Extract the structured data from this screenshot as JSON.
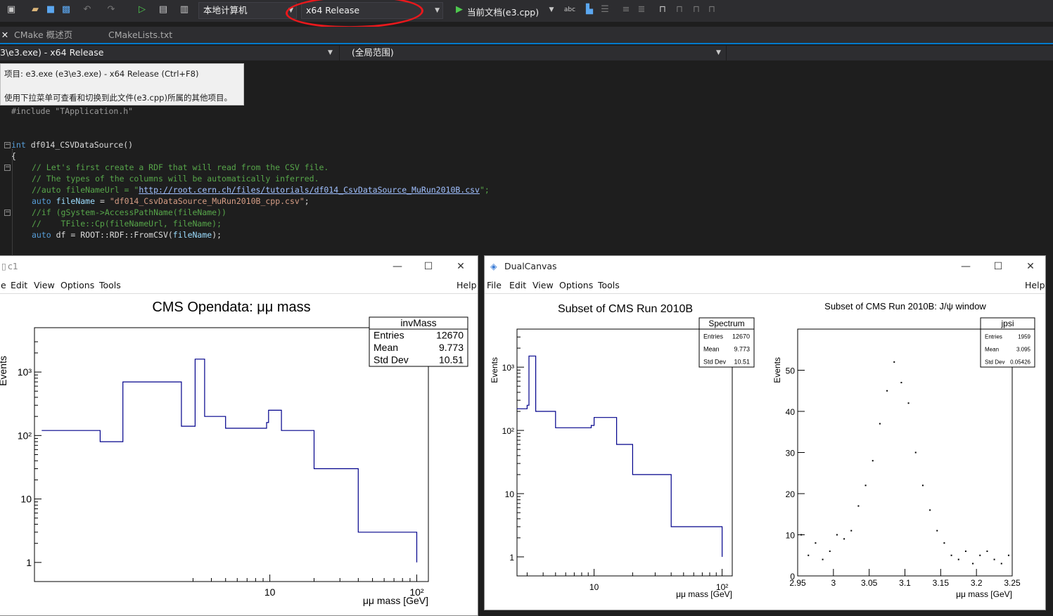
{
  "toolbar": {
    "machine_dropdown": "本地计算机",
    "config_dropdown": "x64 Release",
    "startup_target": "当前文档(e3.cpp)",
    "spell_icon_label": "abc"
  },
  "tabs": [
    {
      "label": "CMake 概述页"
    },
    {
      "label": "CMakeLists.txt"
    }
  ],
  "navbar": {
    "project": "3\\e3.exe) - x64 Release",
    "scope": "(全局范围)"
  },
  "tooltip": {
    "line1": "项目: e3.exe (e3\\e3.exe) - x64 Release (Ctrl+F8)",
    "line2": "使用下拉菜单可查看和切换到此文件(e3.cpp)所属的其他项目。"
  },
  "code": {
    "include": "#include \"TApplication.h\"",
    "fn_kw": "int",
    "fn_name": " df014_CSVDataSource()",
    "brace": "{",
    "c1": "// Let's first create a RDF that will read from the CSV file.",
    "c2": "// The types of the columns will be automatically inferred.",
    "c3_pre": "//auto fileNameUrl = \"",
    "c3_link": "http://root.cern.ch/files/tutorials/df014_CsvDataSource_MuRun2010B.csv",
    "c3_post": "\";",
    "l4_kw": "auto",
    "l4_id": "fileName",
    "l4_eq": " = ",
    "l4_str": "\"df014_CsvDataSource_MuRun2010B_cpp.csv\"",
    "l4_end": ";",
    "c5": "//if (gSystem->AccessPathName(fileName))",
    "c6": "//    TFile::Cp(fileNameUrl, fileName);",
    "l7_kw": "auto",
    "l7_rest": " df = ROOT::RDF::FromCSV(",
    "l7_id": "fileName",
    "l7_end": ");"
  },
  "windows": {
    "c1": {
      "title": "c1",
      "menu": [
        "e",
        "Edit",
        "View",
        "Options",
        "Tools"
      ],
      "help": "Help"
    },
    "dual": {
      "title": "DualCanvas",
      "menu": [
        "File",
        "Edit",
        "View",
        "Options",
        "Tools"
      ],
      "help": "Help"
    }
  },
  "chart_data": [
    {
      "type": "line",
      "title": "CMS Opendata: μμ mass",
      "ylabel": "Events",
      "xlabel": "μμ mass [GeV]",
      "log_x": true,
      "log_y": true,
      "xlim": [
        0.25,
        120
      ],
      "ylim": [
        0.5,
        5000
      ],
      "x_tick_labels": [
        "10",
        "10²"
      ],
      "y_tick_labels": [
        "1",
        "10",
        "10²",
        "10³"
      ],
      "stats": {
        "name": "invMass",
        "entries": "12670",
        "mean": "9.773",
        "std_dev": "10.51",
        "labels": [
          "Entries",
          "Mean",
          "Std Dev"
        ]
      },
      "series": [
        {
          "x": [
            0.28,
            0.7,
            1.0,
            2.5,
            3.1,
            3.6,
            5.0,
            9.5,
            9.8,
            12,
            20,
            40,
            100
          ],
          "values": [
            120,
            80,
            700,
            140,
            1600,
            200,
            130,
            160,
            250,
            120,
            30,
            3,
            1
          ]
        }
      ]
    },
    {
      "type": "line",
      "title": "Subset of CMS Run 2010B",
      "ylabel": "Events",
      "xlabel": "μμ mass [GeV]",
      "log_x": true,
      "log_y": true,
      "xlim": [
        2.5,
        120
      ],
      "ylim": [
        0.5,
        4000
      ],
      "x_tick_labels": [
        "10",
        "10²"
      ],
      "y_tick_labels": [
        "1",
        "10",
        "10²",
        "10³"
      ],
      "stats": {
        "name": "Spectrum",
        "entries": "12670",
        "mean": "9.773",
        "std_dev": "10.51",
        "labels": [
          "Entries",
          "Mean",
          "Std Dev"
        ]
      },
      "series": [
        {
          "x": [
            2.5,
            3.0,
            3.1,
            3.5,
            5,
            9.5,
            10,
            15,
            20,
            40,
            100
          ],
          "values": [
            220,
            250,
            1500,
            200,
            110,
            120,
            160,
            60,
            20,
            3,
            1
          ]
        }
      ]
    },
    {
      "type": "scatter",
      "title": "Subset of CMS Run 2010B: J/ψ window",
      "ylabel": "Events",
      "xlabel": "μμ mass [GeV]",
      "xlim": [
        2.95,
        3.25
      ],
      "ylim": [
        0,
        60
      ],
      "x_tick_labels": [
        "2.95",
        "3",
        "3.05",
        "3.1",
        "3.15",
        "3.2",
        "3.25"
      ],
      "y_tick_labels": [
        "0",
        "10",
        "20",
        "30",
        "40",
        "50"
      ],
      "stats": {
        "name": "jpsi",
        "entries": "1959",
        "mean": "3.095",
        "std_dev": "0.05426",
        "labels": [
          "Entries",
          "Mean",
          "Std Dev"
        ]
      },
      "x": [
        2.955,
        2.965,
        2.975,
        2.985,
        2.995,
        3.005,
        3.015,
        3.025,
        3.035,
        3.045,
        3.055,
        3.065,
        3.075,
        3.085,
        3.095,
        3.105,
        3.115,
        3.125,
        3.135,
        3.145,
        3.155,
        3.165,
        3.175,
        3.185,
        3.195,
        3.205,
        3.215,
        3.225,
        3.235,
        3.245
      ],
      "values": [
        10,
        5,
        8,
        4,
        6,
        10,
        9,
        11,
        17,
        22,
        28,
        37,
        45,
        52,
        47,
        42,
        30,
        22,
        16,
        11,
        8,
        5,
        4,
        6,
        3,
        5,
        6,
        4,
        3,
        5
      ]
    }
  ]
}
